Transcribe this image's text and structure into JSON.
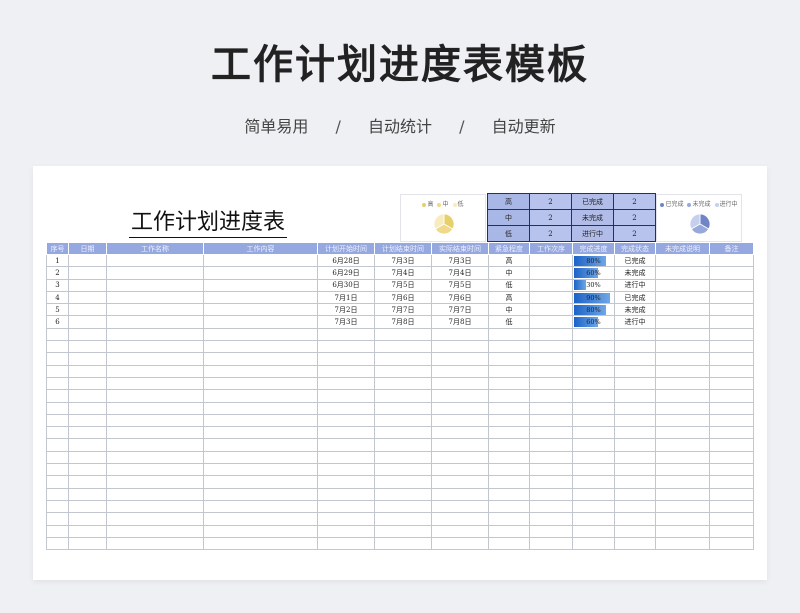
{
  "header": {
    "title": "工作计划进度表模板",
    "subtitle": [
      "简单易用",
      "自动统计",
      "自动更新"
    ],
    "separator": "/"
  },
  "sheet": {
    "title": "工作计划进度表",
    "pie_left": {
      "legend": [
        "高",
        "中",
        "低"
      ],
      "colors": [
        "#e7cf6a",
        "#f0d98a",
        "#f8ecbf"
      ],
      "values": [
        2,
        2,
        2
      ]
    },
    "pie_right": {
      "legend": [
        "已完成",
        "未完成",
        "进行中"
      ],
      "colors": [
        "#6f85c7",
        "#96a8dc",
        "#c5cfee"
      ],
      "values": [
        2,
        2,
        2
      ]
    },
    "summary": [
      {
        "level": "高",
        "level_count": "2",
        "status": "已完成",
        "status_count": "2"
      },
      {
        "level": "中",
        "level_count": "2",
        "status": "未完成",
        "status_count": "2"
      },
      {
        "level": "低",
        "level_count": "2",
        "status": "进行中",
        "status_count": "2"
      }
    ],
    "columns": [
      "序号",
      "日期",
      "工作名称",
      "工作内容",
      "计划开始时间",
      "计划结束时间",
      "实际结束时间",
      "紧急程度",
      "工作次序",
      "完成进度",
      "完成状态",
      "未完成说明",
      "备注"
    ],
    "rows": [
      {
        "no": "1",
        "plan_start": "6月28日",
        "plan_end": "7月3日",
        "actual_end": "7月3日",
        "urgency": "高",
        "progress": 80,
        "progress_label": "80%",
        "status": "已完成"
      },
      {
        "no": "2",
        "plan_start": "6月29日",
        "plan_end": "7月4日",
        "actual_end": "7月4日",
        "urgency": "中",
        "progress": 60,
        "progress_label": "60%",
        "status": "未完成"
      },
      {
        "no": "3",
        "plan_start": "6月30日",
        "plan_end": "7月5日",
        "actual_end": "7月5日",
        "urgency": "低",
        "progress": 30,
        "progress_label": "30%",
        "status": "进行中"
      },
      {
        "no": "4",
        "plan_start": "7月1日",
        "plan_end": "7月6日",
        "actual_end": "7月6日",
        "urgency": "高",
        "progress": 90,
        "progress_label": "90%",
        "status": "已完成"
      },
      {
        "no": "5",
        "plan_start": "7月2日",
        "plan_end": "7月7日",
        "actual_end": "7月7日",
        "urgency": "中",
        "progress": 80,
        "progress_label": "80%",
        "status": "未完成"
      },
      {
        "no": "6",
        "plan_start": "7月3日",
        "plan_end": "7月8日",
        "actual_end": "7月8日",
        "urgency": "低",
        "progress": 60,
        "progress_label": "60%",
        "status": "进行中"
      }
    ]
  }
}
